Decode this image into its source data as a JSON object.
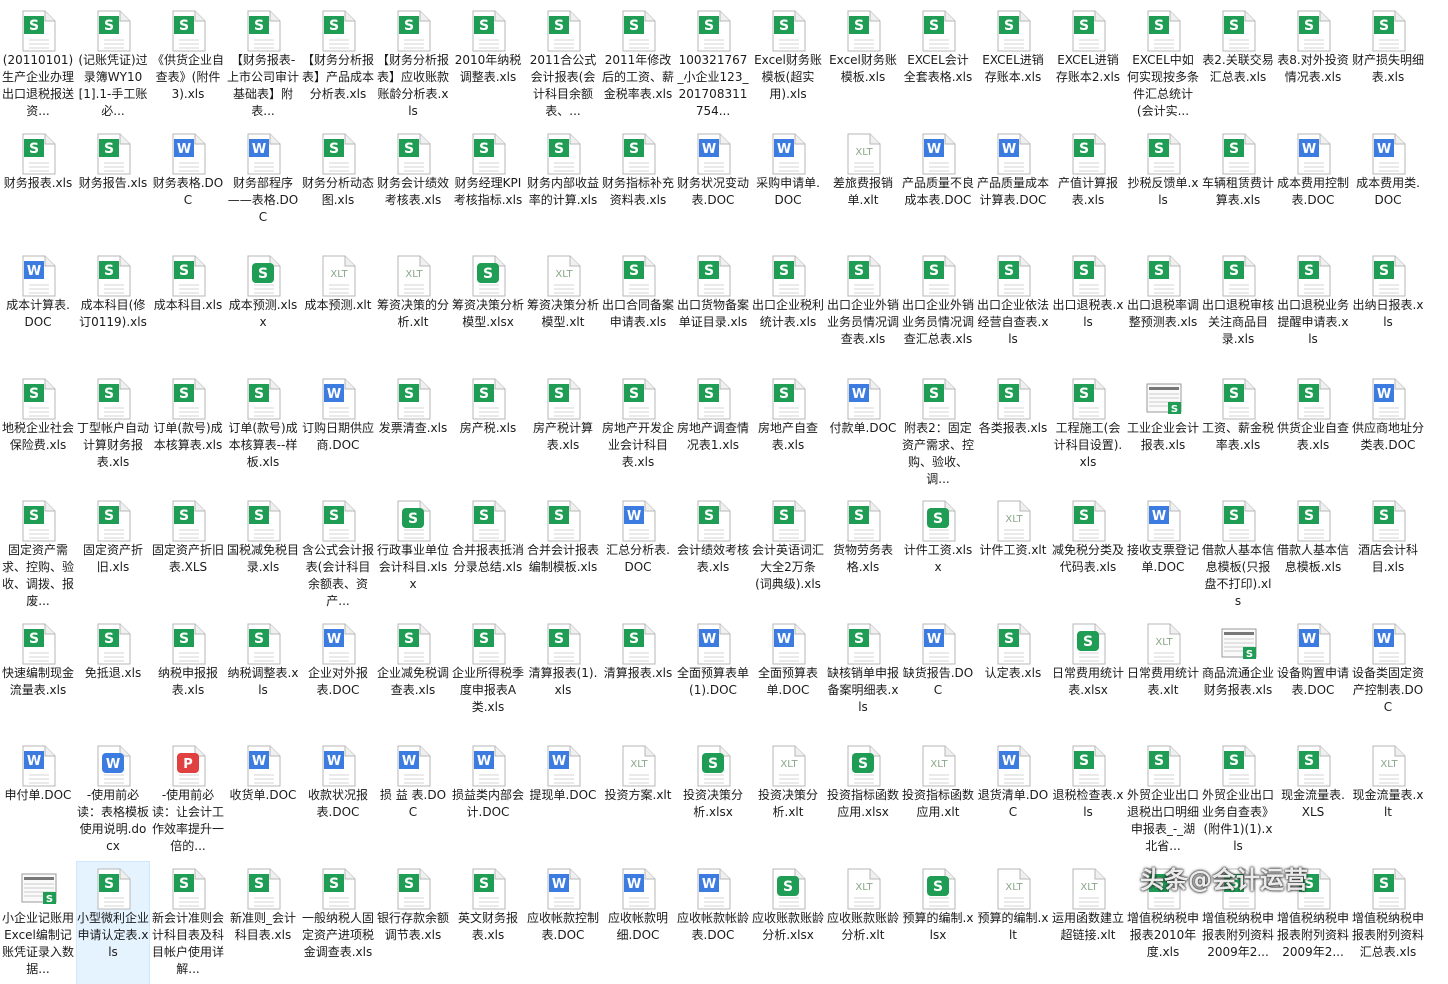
{
  "colors": {
    "xls": "#1f9d55",
    "doc": "#3c7be0",
    "pdf": "#e04040",
    "xlt": "#8aa78a",
    "selection": "#e5f3ff"
  },
  "watermark": "头条@会计运营",
  "files": [
    {
      "name": "(20110101)生产企业办理出口退税报送资...",
      "type": "xls"
    },
    {
      "name": "(记账凭证)过录簿WY10[1].1-手工账必...",
      "type": "xls"
    },
    {
      "name": "《供货企业自查表》(附件3).xls",
      "type": "xls"
    },
    {
      "name": "【财务报表-上市公司审计基础表】附表...",
      "type": "xls"
    },
    {
      "name": "【财务分析报表】产品成本分析表.xls",
      "type": "xls"
    },
    {
      "name": "【财务分析报表】应收账款账龄分析表.xls",
      "type": "xls"
    },
    {
      "name": "2010年纳税调整表.xls",
      "type": "xls"
    },
    {
      "name": "2011合公式会计报表(会计科目余额表、...",
      "type": "xls"
    },
    {
      "name": "2011年修改后的工资、薪金税率表.xls",
      "type": "xls"
    },
    {
      "name": "100321767_小企业123_201708311754...",
      "type": "xls"
    },
    {
      "name": "Excel财务账模板(超实用).xls",
      "type": "xls"
    },
    {
      "name": "Excel财务账模板.xls",
      "type": "xls"
    },
    {
      "name": "EXCEL会计全套表格.xls",
      "type": "xls"
    },
    {
      "name": "EXCEL进销存账本.xls",
      "type": "xls"
    },
    {
      "name": "EXCEL进销存账本2.xls",
      "type": "xls"
    },
    {
      "name": "EXCEL中如何实现按多条件汇总统计(会计实...",
      "type": "xls"
    },
    {
      "name": "表2.关联交易汇总表.xls",
      "type": "xls"
    },
    {
      "name": "表8.对外投资情况表.xls",
      "type": "xls"
    },
    {
      "name": "财产损失明细表.xls",
      "type": "xls"
    },
    {
      "name": "财务报表.xls",
      "type": "xls"
    },
    {
      "name": "财务报告.xls",
      "type": "xls"
    },
    {
      "name": "财务表格.DOC",
      "type": "doc"
    },
    {
      "name": "财务部程序——表格.DOC",
      "type": "doc"
    },
    {
      "name": "财务分析动态图.xls",
      "type": "xls"
    },
    {
      "name": "财务会计绩效考核表.xls",
      "type": "xls"
    },
    {
      "name": "财务经理KPI考核指标.xls",
      "type": "xls"
    },
    {
      "name": "财务内部收益率的计算.xls",
      "type": "xls"
    },
    {
      "name": "财务指标补充资料表.xls",
      "type": "xls"
    },
    {
      "name": "财务状况变动表.DOC",
      "type": "doc"
    },
    {
      "name": "采购申请单.DOC",
      "type": "doc"
    },
    {
      "name": "差旅费报销单.xlt",
      "type": "xlt"
    },
    {
      "name": "产品质量不良成本表.DOC",
      "type": "doc"
    },
    {
      "name": "产品质量成本计算表.DOC",
      "type": "doc"
    },
    {
      "name": "产值计算报表.xls",
      "type": "xls"
    },
    {
      "name": "抄税反馈单.xls",
      "type": "xls"
    },
    {
      "name": "车辆租赁费计算表.xls",
      "type": "xls"
    },
    {
      "name": "成本费用控制表.DOC",
      "type": "doc"
    },
    {
      "name": "成本费用类.DOC",
      "type": "doc"
    },
    {
      "name": "成本计算表.DOC",
      "type": "doc"
    },
    {
      "name": "成本科目(修订0119).xls",
      "type": "xls"
    },
    {
      "name": "成本科目.xls",
      "type": "xls"
    },
    {
      "name": "成本预测.xlsx",
      "type": "xlsx"
    },
    {
      "name": "成本预测.xlt",
      "type": "xlt"
    },
    {
      "name": "筹资决策的分析.xlt",
      "type": "xlt"
    },
    {
      "name": "筹资决策分析模型.xlsx",
      "type": "xlsx"
    },
    {
      "name": "筹资决策分析模型.xlt",
      "type": "xlt"
    },
    {
      "name": "出口合同备案申请表.xls",
      "type": "xls"
    },
    {
      "name": "出口货物备案单证目录.xls",
      "type": "xls"
    },
    {
      "name": "出口企业税利统计表.xls",
      "type": "xls"
    },
    {
      "name": "出口企业外销业务员情况调查表.xls",
      "type": "xls"
    },
    {
      "name": "出口企业外销业务员情况调查汇总表.xls",
      "type": "xls"
    },
    {
      "name": "出口企业依法经营自查表.xls",
      "type": "xls"
    },
    {
      "name": "出口退税表.xls",
      "type": "xls"
    },
    {
      "name": "出口退税率调整预测表.xls",
      "type": "xls"
    },
    {
      "name": "出口退税审核关注商品目录.xls",
      "type": "xls"
    },
    {
      "name": "出口退税业务提醒申请表.xls",
      "type": "xls"
    },
    {
      "name": "出纳日报表.xls",
      "type": "xls"
    },
    {
      "name": "地税企业社会保险费.xls",
      "type": "xls"
    },
    {
      "name": "丁型帐户自动计算财务报表.xls",
      "type": "xls"
    },
    {
      "name": "订单(款号)成本核算表.xls",
      "type": "xls"
    },
    {
      "name": "订单(款号)成本核算表--样板.xls",
      "type": "xls"
    },
    {
      "name": "订购日期供应商.DOC",
      "type": "doc"
    },
    {
      "name": "发票清查.xls",
      "type": "xls"
    },
    {
      "name": "房产税.xls",
      "type": "xls"
    },
    {
      "name": "房产税计算表.xls",
      "type": "xls"
    },
    {
      "name": "房地产开发企业会计科目表.xls",
      "type": "xls"
    },
    {
      "name": "房地产调查情况表1.xls",
      "type": "xls"
    },
    {
      "name": "房地产自查表.xls",
      "type": "xls"
    },
    {
      "name": "付款单.DOC",
      "type": "doc"
    },
    {
      "name": "附表2：固定资产需求、控购、验收、调...",
      "type": "xls"
    },
    {
      "name": "各类报表.xls",
      "type": "xls"
    },
    {
      "name": "工程施工(会计科目设置).xls",
      "type": "xls"
    },
    {
      "name": "工业企业会计报表.xls",
      "type": "thumb"
    },
    {
      "name": "工资、薪金税率表.xls",
      "type": "xls"
    },
    {
      "name": "供货企业自查表.xls",
      "type": "xls"
    },
    {
      "name": "供应商地址分类表.DOC",
      "type": "doc"
    },
    {
      "name": "固定资产需求、控购、验收、调拨、报废...",
      "type": "xls"
    },
    {
      "name": "固定资产折旧.xls",
      "type": "xls"
    },
    {
      "name": "固定资产折旧表.XLS",
      "type": "xls"
    },
    {
      "name": "国税减免税目录.xls",
      "type": "xls"
    },
    {
      "name": "含公式会计报表(会计科目余额表、资产...",
      "type": "xls"
    },
    {
      "name": "行政事业单位会计科目.xlsx",
      "type": "xlsx"
    },
    {
      "name": "合并报表抵消分录总结.xls",
      "type": "xls"
    },
    {
      "name": "合并会计报表编制模板.xls",
      "type": "xls"
    },
    {
      "name": "汇总分析表.DOC",
      "type": "doc"
    },
    {
      "name": "会计绩效考核表.xls",
      "type": "xls"
    },
    {
      "name": "会计英语词汇大全2万条(词典级).xls",
      "type": "xls"
    },
    {
      "name": "货物劳务表格.xls",
      "type": "xls"
    },
    {
      "name": "计件工资.xlsx",
      "type": "xlsx"
    },
    {
      "name": "计件工资.xlt",
      "type": "xlt"
    },
    {
      "name": "减免税分类及代码表.xls",
      "type": "xls"
    },
    {
      "name": "接收支票登记单.DOC",
      "type": "doc"
    },
    {
      "name": "借款人基本信息模板(只报盘不打印).xls",
      "type": "xls"
    },
    {
      "name": "借款人基本信息模板.xls",
      "type": "xls"
    },
    {
      "name": "酒店会计科目.xls",
      "type": "xls"
    },
    {
      "name": "快速编制现金流量表.xls",
      "type": "xls"
    },
    {
      "name": "免抵退.xls",
      "type": "xls"
    },
    {
      "name": "纳税申报报表.xls",
      "type": "xls"
    },
    {
      "name": "纳税调整表.xls",
      "type": "xls"
    },
    {
      "name": "企业对外报表.DOC",
      "type": "doc"
    },
    {
      "name": "企业减免税调查表.xls",
      "type": "xls"
    },
    {
      "name": "企业所得税季度申报表A类.xls",
      "type": "xls"
    },
    {
      "name": "清算报表(1).xls",
      "type": "xls"
    },
    {
      "name": "清算报表.xls",
      "type": "xls"
    },
    {
      "name": "全面预算表单(1).DOC",
      "type": "doc"
    },
    {
      "name": "全面预算表单.DOC",
      "type": "doc"
    },
    {
      "name": "缺核销单申报备案明细表.xls",
      "type": "xls"
    },
    {
      "name": "缺货报告.DOC",
      "type": "doc"
    },
    {
      "name": "认定表.xls",
      "type": "xls"
    },
    {
      "name": "日常费用统计表.xlsx",
      "type": "xlsx"
    },
    {
      "name": "日常费用统计表.xlt",
      "type": "xlt"
    },
    {
      "name": "商品流通企业财务报表.xls",
      "type": "thumb"
    },
    {
      "name": "设备购置申请表.DOC",
      "type": "doc"
    },
    {
      "name": "设备类固定资产控制表.DOC",
      "type": "doc"
    },
    {
      "name": "申付单.DOC",
      "type": "doc"
    },
    {
      "name": "-使用前必读：表格模板使用说明.docx",
      "type": "docx"
    },
    {
      "name": "-使用前必读：让会计工作效率提升一倍的...",
      "type": "pdf"
    },
    {
      "name": "收货单.DOC",
      "type": "doc"
    },
    {
      "name": "收款状况报表.DOC",
      "type": "doc"
    },
    {
      "name": "损 益 表.DOC",
      "type": "doc"
    },
    {
      "name": "损益类内部会计.DOC",
      "type": "doc"
    },
    {
      "name": "提现单.DOC",
      "type": "doc"
    },
    {
      "name": "投资方案.xlt",
      "type": "xlt"
    },
    {
      "name": "投资决策分析.xlsx",
      "type": "xlsx"
    },
    {
      "name": "投资决策分析.xlt",
      "type": "xlt"
    },
    {
      "name": "投资指标函数应用.xlsx",
      "type": "xlsx"
    },
    {
      "name": "投资指标函数应用.xlt",
      "type": "xlt"
    },
    {
      "name": "退货清单.DOC",
      "type": "doc"
    },
    {
      "name": "退税检查表.xls",
      "type": "xls"
    },
    {
      "name": "外贸企业出口退税出口明细申报表_-_湖北省...",
      "type": "xls"
    },
    {
      "name": "外贸企业出口业务自查表》(附件1)(1).xls",
      "type": "xls"
    },
    {
      "name": "现金流量表.XLS",
      "type": "xls"
    },
    {
      "name": "现金流量表.xlt",
      "type": "xlt"
    },
    {
      "name": "小企业记账用Excel编制记账凭证录入数据...",
      "type": "thumb"
    },
    {
      "name": "小型微利企业申请认定表.xls",
      "type": "xls",
      "selected": true
    },
    {
      "name": "新会计准则会计科目表及科目帐户使用详解...",
      "type": "xls"
    },
    {
      "name": "新准则_会计科目表.xls",
      "type": "xls"
    },
    {
      "name": "一般纳税人固定资产进项税金调查表.xls",
      "type": "xls"
    },
    {
      "name": "银行存款余额调节表.xls",
      "type": "xls"
    },
    {
      "name": "英文财务报表.xls",
      "type": "xls"
    },
    {
      "name": "应收帐款控制表.DOC",
      "type": "doc"
    },
    {
      "name": "应收帐款明细.DOC",
      "type": "doc"
    },
    {
      "name": "应收帐款帐龄表.DOC",
      "type": "doc"
    },
    {
      "name": "应收账款账龄分析.xlsx",
      "type": "xlsx"
    },
    {
      "name": "应收账款账龄分析.xlt",
      "type": "xlt"
    },
    {
      "name": "预算的编制.xlsx",
      "type": "xlsx"
    },
    {
      "name": "预算的编制.xlt",
      "type": "xlt"
    },
    {
      "name": "运用函数建立超链接.xlt",
      "type": "xlt"
    },
    {
      "name": "增值税纳税申报表2010年度.xls",
      "type": "xls"
    },
    {
      "name": "增值税纳税申报表附列资料2009年2...",
      "type": "xls"
    },
    {
      "name": "增值税纳税申报表附列资料2009年2...",
      "type": "xls"
    },
    {
      "name": "增值税纳税申报表附列资料汇总表.xls",
      "type": "xls"
    }
  ]
}
